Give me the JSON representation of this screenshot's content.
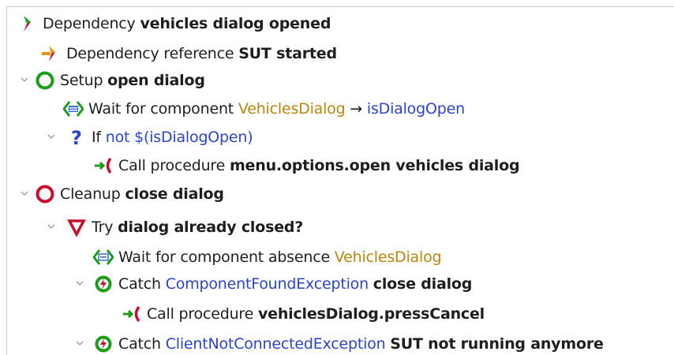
{
  "colors": {
    "dependency": "#c8102e",
    "green": "#1a9e1a",
    "red": "#c8102e",
    "orange": "#e69419",
    "blue": "#2c44c8",
    "gold": "#b8860b"
  },
  "tree": {
    "dependency": {
      "prefix": "Dependency",
      "name": "vehicles dialog opened",
      "icon": "dependency-icon"
    },
    "dependency_reference": {
      "prefix": "Dependency reference",
      "name": "SUT started",
      "icon": "dependency-reference-icon"
    },
    "setup": {
      "prefix": "Setup",
      "name": "open dialog",
      "icon": "setup-icon",
      "expanded": true
    },
    "wait_component": {
      "prefix": "Wait for component",
      "component": "VehiclesDialog",
      "arrow": "→",
      "variable": "isDialogOpen",
      "icon": "wait-component-icon"
    },
    "if_node": {
      "prefix": "If",
      "condition": "not $(isDialogOpen)",
      "icon": "if-icon",
      "expanded": true
    },
    "call_open": {
      "prefix": "Call procedure",
      "procedure": "menu.options.open vehicles dialog",
      "icon": "call-procedure-icon"
    },
    "cleanup": {
      "prefix": "Cleanup",
      "name": "close dialog",
      "icon": "cleanup-icon",
      "expanded": true
    },
    "try_node": {
      "prefix": "Try",
      "name": "dialog already closed?",
      "icon": "try-icon",
      "expanded": true
    },
    "wait_absence": {
      "prefix": "Wait for component absence",
      "component": "VehiclesDialog",
      "icon": "wait-component-icon"
    },
    "catch_found": {
      "prefix": "Catch",
      "exception": "ComponentFoundException",
      "name": "close dialog",
      "icon": "catch-icon",
      "expanded": true
    },
    "call_cancel": {
      "prefix": "Call procedure",
      "procedure": "vehiclesDialog.pressCancel",
      "icon": "call-procedure-icon"
    },
    "catch_not_connected": {
      "prefix": "Catch",
      "exception": "ClientNotConnectedException",
      "name": "SUT not running anymore",
      "icon": "catch-icon",
      "expanded": true
    }
  }
}
